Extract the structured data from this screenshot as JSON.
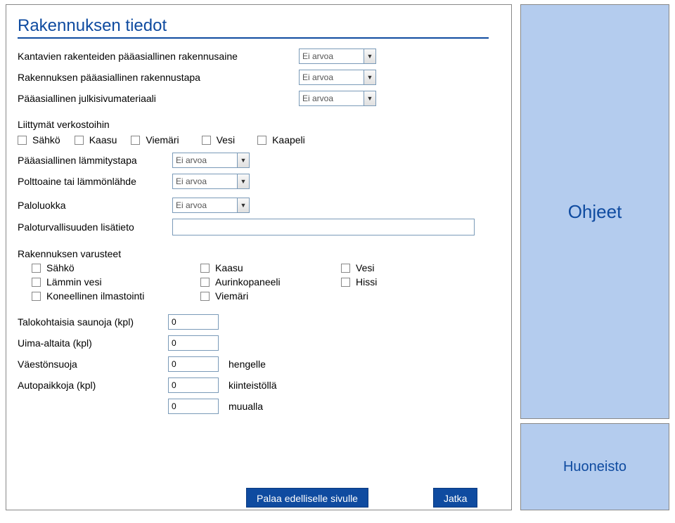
{
  "title": "Rakennuksen tiedot",
  "fields": {
    "material": {
      "label": "Kantavien rakenteiden pääasiallinen rakennusaine",
      "value": "Ei arvoa"
    },
    "method": {
      "label": "Rakennuksen pääasiallinen rakennustapa",
      "value": "Ei arvoa"
    },
    "facade": {
      "label": "Pääasiallinen julkisivumateriaali",
      "value": "Ei arvoa"
    }
  },
  "networks": {
    "label": "Liittymät verkostoihin",
    "items": [
      "Sähkö",
      "Kaasu",
      "Viemäri",
      "Vesi",
      "Kaapeli"
    ]
  },
  "heat_method": {
    "label": "Pääasiallinen lämmitystapa",
    "value": "Ei arvoa"
  },
  "fuel": {
    "label": "Polttoaine tai lämmönlähde",
    "value": "Ei arvoa"
  },
  "fire_class": {
    "label": "Paloluokka",
    "value": "Ei arvoa"
  },
  "fire_info": {
    "label": "Paloturvallisuuden lisätieto"
  },
  "equip": {
    "label": "Rakennuksen varusteet",
    "rows": [
      [
        "Sähkö",
        "Kaasu",
        "Vesi"
      ],
      [
        "Lämmin vesi",
        "Aurinkopaneeli",
        "Hissi"
      ],
      [
        "Koneellinen ilmastointi",
        "Viemäri",
        ""
      ]
    ]
  },
  "counts": {
    "sauna": {
      "label": "Talokohtaisia saunoja (kpl)",
      "value": "0"
    },
    "pool": {
      "label": "Uima-altaita (kpl)",
      "value": "0"
    },
    "shelter": {
      "label": "Väestönsuoja",
      "value": "0",
      "suffix": "hengelle"
    },
    "parking": {
      "label": "Autopaikkoja (kpl)",
      "value": "0",
      "suffix": "kiinteistöllä"
    },
    "parking2": {
      "value": "0",
      "suffix": "muualla"
    }
  },
  "buttons": {
    "back": "Palaa edelliselle sivulle",
    "next": "Jatka"
  },
  "help": "Ohjeet",
  "section": "Huoneisto"
}
